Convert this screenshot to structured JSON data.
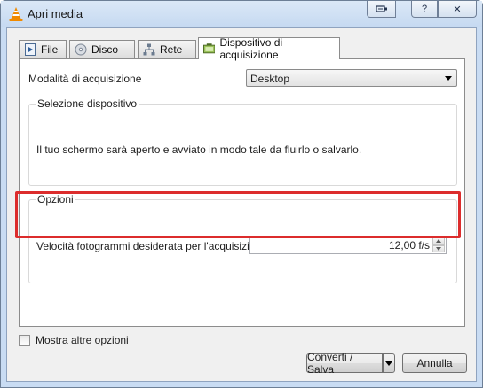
{
  "window": {
    "title": "Apri media",
    "controls": [
      "pin-icon",
      "help-icon",
      "close-icon"
    ],
    "controls_text": {
      "help": "?",
      "close": "✕"
    }
  },
  "tabs": [
    {
      "label": "File",
      "icon": "file-play-icon",
      "selected": false
    },
    {
      "label": "Disco",
      "icon": "disc-icon",
      "selected": false
    },
    {
      "label": "Rete",
      "icon": "network-icon",
      "selected": false
    },
    {
      "label": "Dispositivo di acquisizione",
      "icon": "capture-device-icon",
      "selected": true
    }
  ],
  "capture": {
    "mode_label": "Modalità di acquisizione",
    "mode_value": "Desktop"
  },
  "device_group": {
    "title": "Selezione dispositivo",
    "description": "Il tuo schermo sarà aperto e avviato in modo tale da fluirlo o salvarlo."
  },
  "options_group": {
    "title": "Opzioni",
    "fps_label": "Velocità fotogrammi desiderata per l'acquisizione.",
    "fps_value": "12,00 f/s"
  },
  "footer": {
    "more_options_label": "Mostra altre opzioni",
    "more_options_checked": false,
    "convert_label": "Converti / Salva",
    "cancel_label": "Annulla"
  },
  "colors": {
    "highlight": "#dc2c2c",
    "vlc_orange": "#f08a00"
  }
}
